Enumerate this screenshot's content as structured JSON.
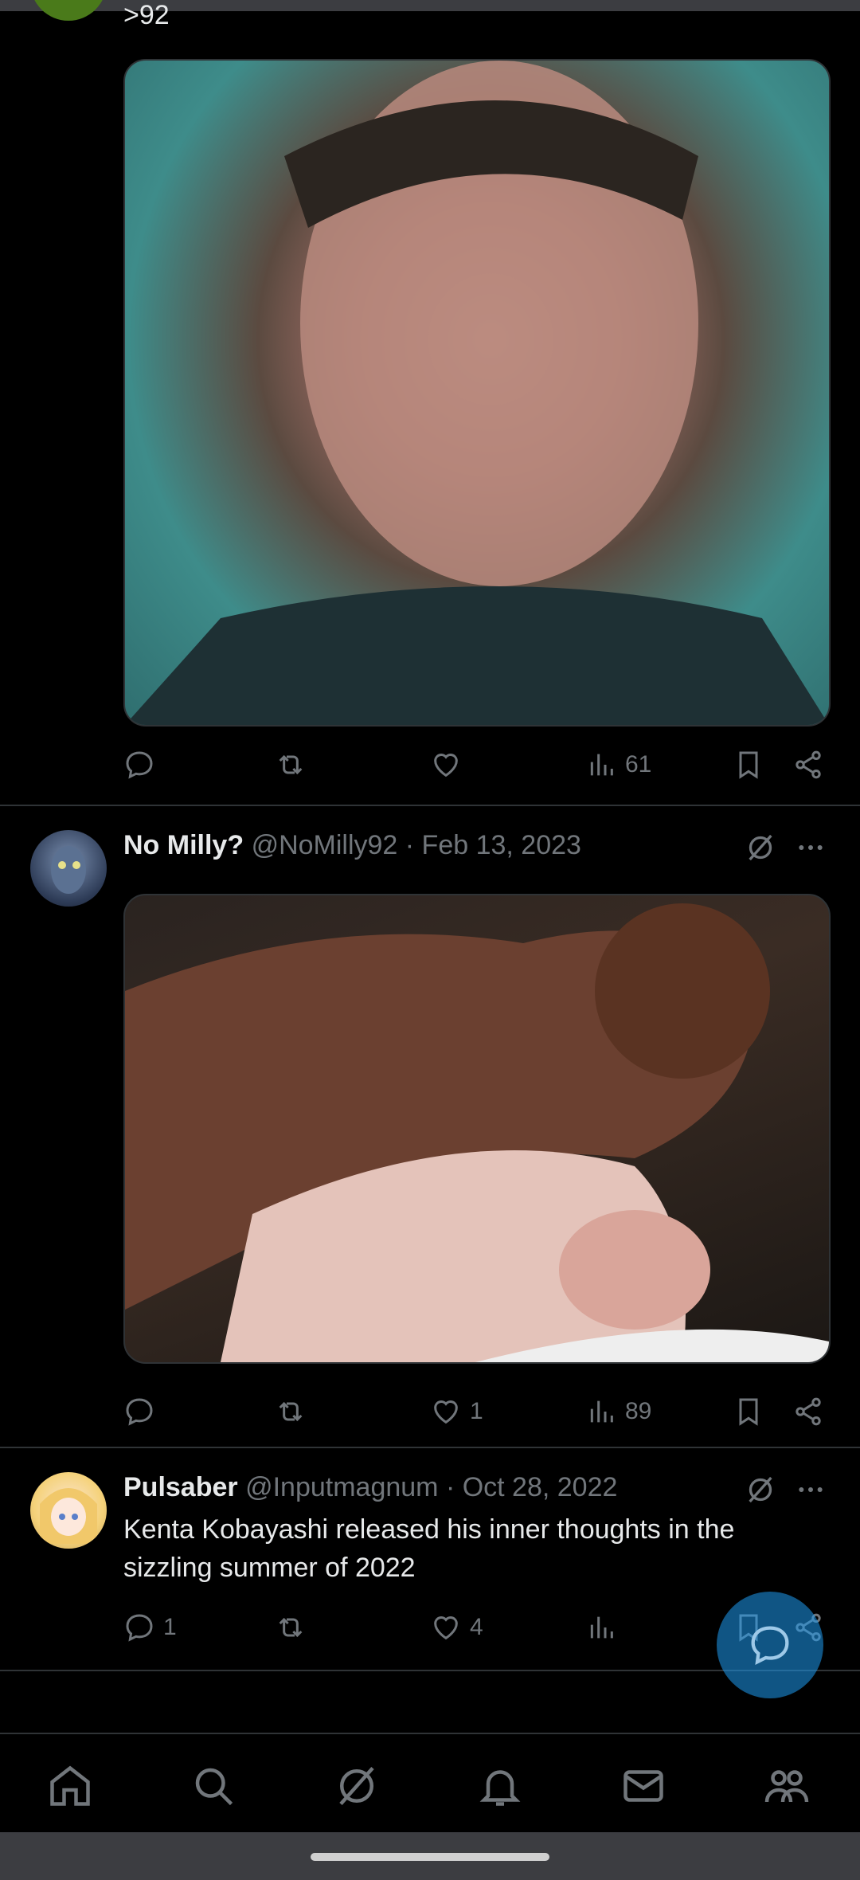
{
  "post1": {
    "cut_text": ">92",
    "stats": {
      "reply": "",
      "repost": "",
      "like": "",
      "views": "61"
    }
  },
  "post2": {
    "name": "No Milly?",
    "meta": "@NoMilly92 · Feb 13, 2023",
    "stats": {
      "reply": "",
      "repost": "",
      "like": "1",
      "views": "89"
    }
  },
  "post3": {
    "name": "Pulsaber",
    "meta": "@Inputmagnum · Oct 28, 2022",
    "text": "Kenta Kobayashi released his inner thoughts in the sizzling summer of 2022",
    "stats": {
      "reply": "1",
      "repost": "",
      "like": "4",
      "views": ""
    }
  },
  "colors": {
    "accent": "#1d9bf0",
    "muted": "#71767b",
    "divider": "#2f3336"
  },
  "nav": [
    "home-icon",
    "search-icon",
    "grok-icon",
    "notifications-icon",
    "messages-icon",
    "communities-icon"
  ]
}
